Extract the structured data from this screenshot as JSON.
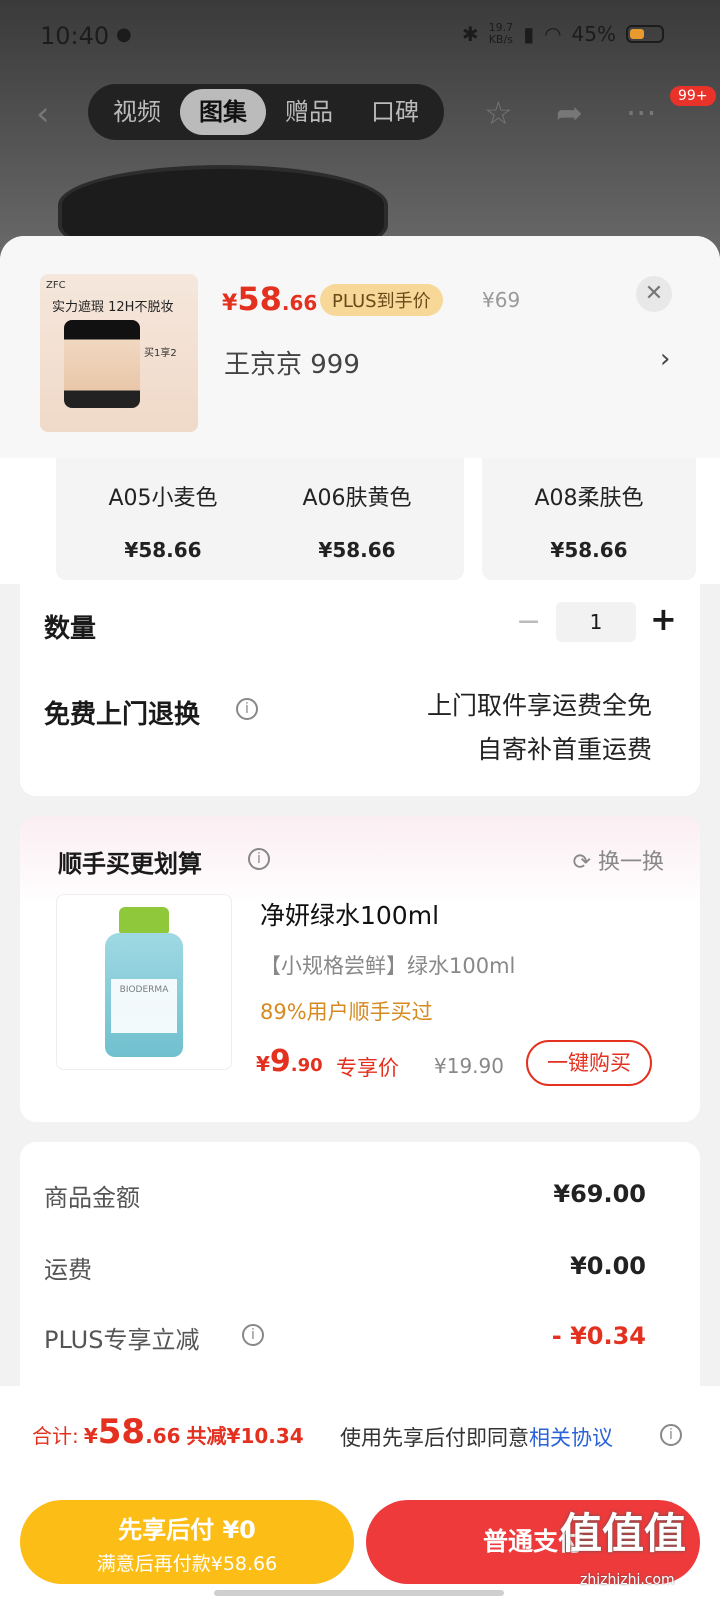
{
  "status": {
    "time": "10:40",
    "speed": "19.7\nKB/s",
    "battery": "45%"
  },
  "nav": {
    "tabs": [
      "视频",
      "图集",
      "赠品",
      "口碑"
    ],
    "badge": "99+"
  },
  "product": {
    "thumb_brand": "ZFC",
    "thumb_slogan": "实力遮瑕 12H不脱妆",
    "thumb_gift": "买1享2",
    "price_currency": "¥",
    "price_int": "58",
    "price_dec": ".66",
    "plus_tag": "PLUS到手价",
    "orig_price": "¥69",
    "address": "王京京  999"
  },
  "variants": [
    {
      "name": "A05小麦色",
      "price": "¥58.66"
    },
    {
      "name": "A06肤黄色",
      "price": "¥58.66"
    },
    {
      "name": "A08柔肤色",
      "price": "¥58.66"
    }
  ],
  "quantity": {
    "label": "数量",
    "value": "1"
  },
  "returns": {
    "label": "免费上门退换",
    "line1": "上门取件享运费全免",
    "line2": "自寄补首重运费"
  },
  "recommend": {
    "title": "顺手买更划算",
    "swap": "换一换",
    "name": "净妍绿水100ml",
    "sub": "【小规格尝鲜】绿水100ml",
    "buyers": "89%用户顺手买过",
    "price_currency": "¥",
    "price_int": "9",
    "price_dec": ".90",
    "exclusive": "专享价",
    "orig": "¥19.90",
    "buy": "一键购买",
    "bottle_label": "BIODERMA"
  },
  "amounts": [
    {
      "label": "商品金额",
      "value": "¥69.00",
      "red": false
    },
    {
      "label": "运费",
      "value": "¥0.00",
      "red": false
    },
    {
      "label": "PLUS专享立减",
      "value": "- ¥0.34",
      "red": true
    }
  ],
  "footer": {
    "total_label": "合计:",
    "total_currency": "¥",
    "total_int": "58",
    "total_dec": ".66",
    "reduce": "共减¥10.34",
    "agree_text": "使用先享后付即同意",
    "agree_link": "相关协议",
    "pay_later_title": "先享后付 ¥0",
    "pay_later_sub": "满意后再付款¥58.66",
    "pay_normal": "普通支付"
  },
  "watermark": {
    "text": "值值值",
    "url": "zhizhizhi.com"
  }
}
